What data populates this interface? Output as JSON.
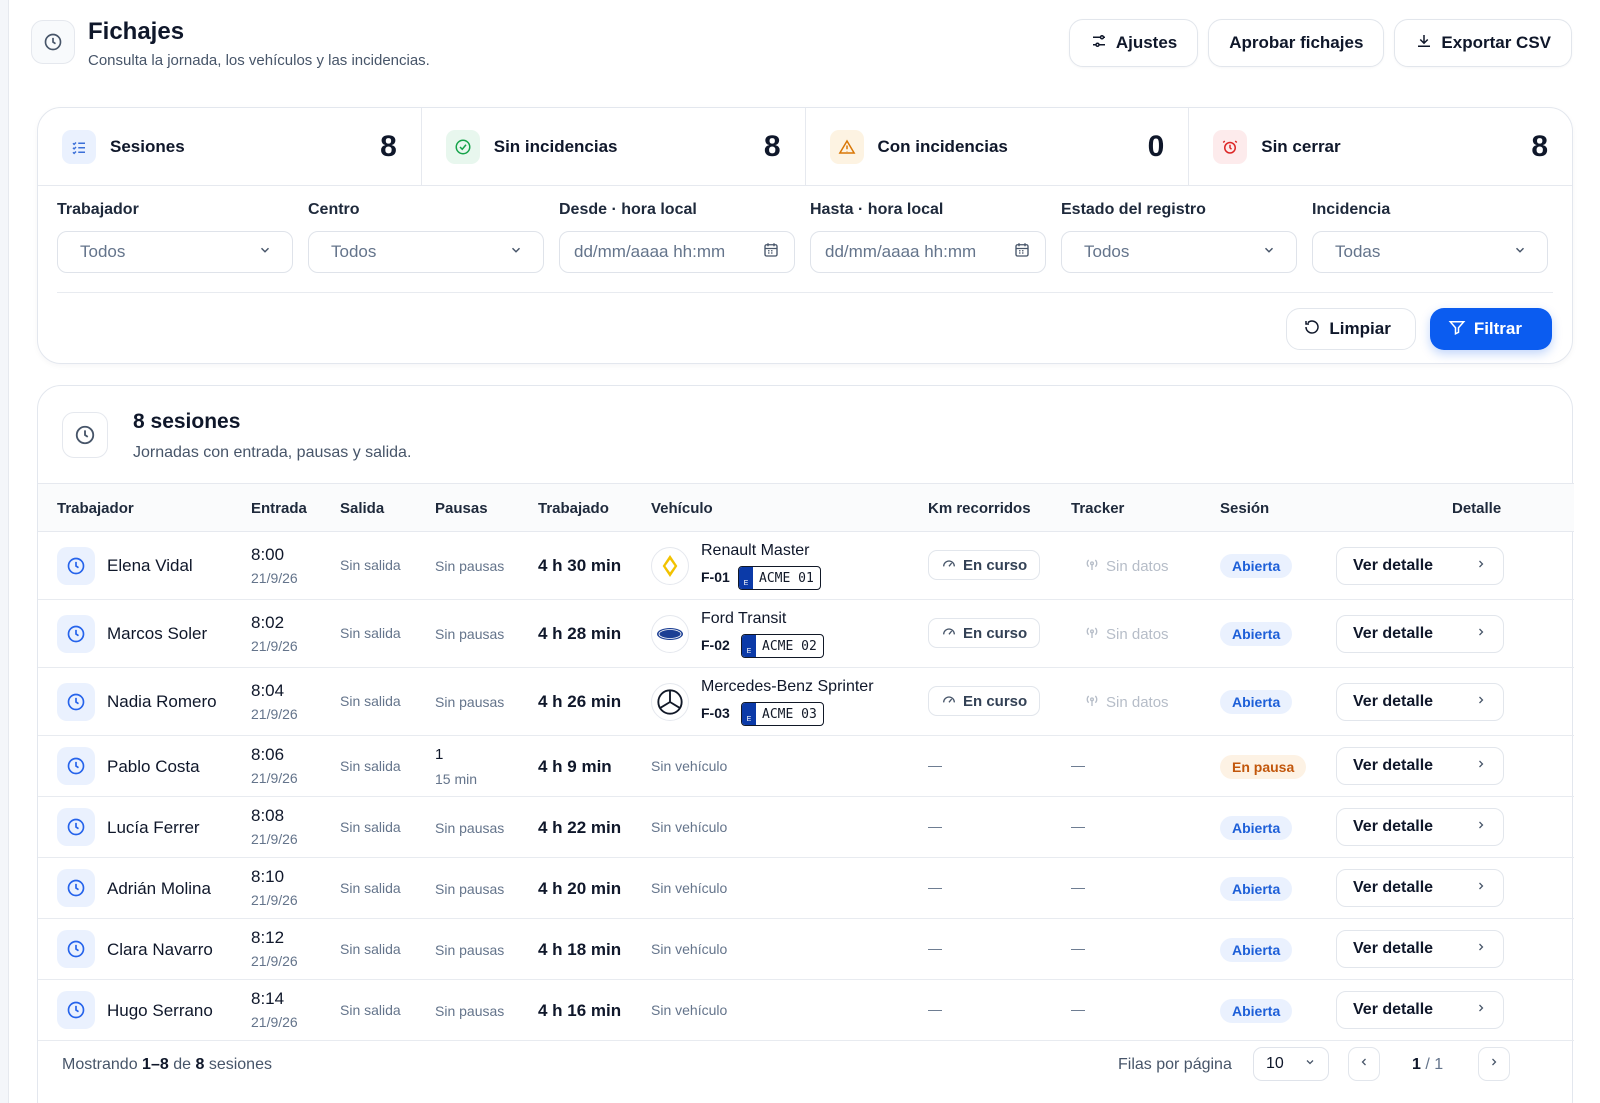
{
  "header": {
    "title": "Fichajes",
    "subtitle": "Consulta la jornada, los vehículos y las incidencias.",
    "buttons": {
      "settings": "Ajustes",
      "approve": "Aprobar fichajes",
      "export": "Exportar CSV"
    }
  },
  "stats": [
    {
      "label": "Sesiones",
      "value": "8",
      "color": "#3b6fd8",
      "bg": "#eaf1fe",
      "icon": "list-check-icon"
    },
    {
      "label": "Sin incidencias",
      "value": "8",
      "color": "#16a34a",
      "bg": "#e8f7ee",
      "icon": "check-circle-icon"
    },
    {
      "label": "Con incidencias",
      "value": "0",
      "color": "#d97706",
      "bg": "#fdf3e2",
      "icon": "warning-icon"
    },
    {
      "label": "Sin cerrar",
      "value": "8",
      "color": "#dc2626",
      "bg": "#fdebec",
      "icon": "alarm-clock-icon"
    }
  ],
  "filters": [
    {
      "label": "Trabajador",
      "value": "Todos",
      "type": "select"
    },
    {
      "label": "Centro",
      "value": "Todos",
      "type": "select"
    },
    {
      "label": "Desde · hora local",
      "placeholder": "dd/mm/aaaa hh:mm",
      "type": "date"
    },
    {
      "label": "Hasta · hora local",
      "placeholder": "dd/mm/aaaa hh:mm",
      "type": "date"
    },
    {
      "label": "Estado del registro",
      "value": "Todos",
      "type": "select"
    },
    {
      "label": "Incidencia",
      "value": "Todas",
      "type": "select"
    }
  ],
  "filter_actions": {
    "clear": "Limpiar",
    "filter": "Filtrar"
  },
  "sessions": {
    "title": "8 sesiones",
    "subtitle": "Jornadas con entrada, pausas y salida.",
    "columns": [
      "Trabajador",
      "Entrada",
      "Salida",
      "Pausas",
      "Trabajado",
      "Vehículo",
      "Km recorridos",
      "Tracker",
      "Sesión",
      "Detalle"
    ],
    "rows": [
      {
        "worker": "Elena Vidal",
        "time": "8:00",
        "date": "21/9/26",
        "exit": "Sin salida",
        "pauses": "Sin pausas",
        "worked": "4 h 30 min",
        "vehicle": {
          "name": "Renault Master",
          "code": "F-01",
          "plate": "ACME 01",
          "logo": "renault-logo-icon",
          "eu": "E"
        },
        "km": "En curso",
        "tracker": "Sin datos",
        "session": "Abierta",
        "detail": "Ver detalle"
      },
      {
        "worker": "Marcos Soler",
        "time": "8:02",
        "date": "21/9/26",
        "exit": "Sin salida",
        "pauses": "Sin pausas",
        "worked": "4 h 28 min",
        "vehicle": {
          "name": "Ford Transit",
          "code": "F-02",
          "plate": "ACME 02",
          "logo": "ford-logo-icon",
          "eu": "E"
        },
        "km": "En curso",
        "tracker": "Sin datos",
        "session": "Abierta",
        "detail": "Ver detalle"
      },
      {
        "worker": "Nadia Romero",
        "time": "8:04",
        "date": "21/9/26",
        "exit": "Sin salida",
        "pauses": "Sin pausas",
        "worked": "4 h 26 min",
        "vehicle": {
          "name": "Mercedes-Benz Sprinter",
          "code": "F-03",
          "plate": "ACME 03",
          "logo": "mercedes-logo-icon",
          "eu": "E"
        },
        "km": "En curso",
        "tracker": "Sin datos",
        "session": "Abierta",
        "detail": "Ver detalle"
      },
      {
        "worker": "Pablo Costa",
        "time": "8:06",
        "date": "21/9/26",
        "exit": "Sin salida",
        "pauses_count": "1",
        "pauses_dur": "15 min",
        "worked": "4 h 9 min",
        "no_vehicle": "Sin vehículo",
        "km": "—",
        "tracker": "—",
        "session": "En pausa",
        "detail": "Ver detalle"
      },
      {
        "worker": "Lucía Ferrer",
        "time": "8:08",
        "date": "21/9/26",
        "exit": "Sin salida",
        "pauses": "Sin pausas",
        "worked": "4 h 22 min",
        "no_vehicle": "Sin vehículo",
        "km": "—",
        "tracker": "—",
        "session": "Abierta",
        "detail": "Ver detalle"
      },
      {
        "worker": "Adrián Molina",
        "time": "8:10",
        "date": "21/9/26",
        "exit": "Sin salida",
        "pauses": "Sin pausas",
        "worked": "4 h 20 min",
        "no_vehicle": "Sin vehículo",
        "km": "—",
        "tracker": "—",
        "session": "Abierta",
        "detail": "Ver detalle"
      },
      {
        "worker": "Clara Navarro",
        "time": "8:12",
        "date": "21/9/26",
        "exit": "Sin salida",
        "pauses": "Sin pausas",
        "worked": "4 h 18 min",
        "no_vehicle": "Sin vehículo",
        "km": "—",
        "tracker": "—",
        "session": "Abierta",
        "detail": "Ver detalle"
      },
      {
        "worker": "Hugo Serrano",
        "time": "8:14",
        "date": "21/9/26",
        "exit": "Sin salida",
        "pauses": "Sin pausas",
        "worked": "4 h 16 min",
        "no_vehicle": "Sin vehículo",
        "km": "—",
        "tracker": "—",
        "session": "Abierta",
        "detail": "Ver detalle"
      }
    ]
  },
  "footer": {
    "showing_prefix": "Mostrando",
    "range": "1–8",
    "of": "de",
    "total": "8",
    "suffix": "sesiones",
    "rows_per_page_label": "Filas por página",
    "rows_per_page": "10",
    "page_current": "1",
    "page_total": "/ 1"
  },
  "colors": {
    "accent": "#0b5cf0",
    "open_badge": "#1d5fd8",
    "pause_badge": "#c2570c"
  }
}
